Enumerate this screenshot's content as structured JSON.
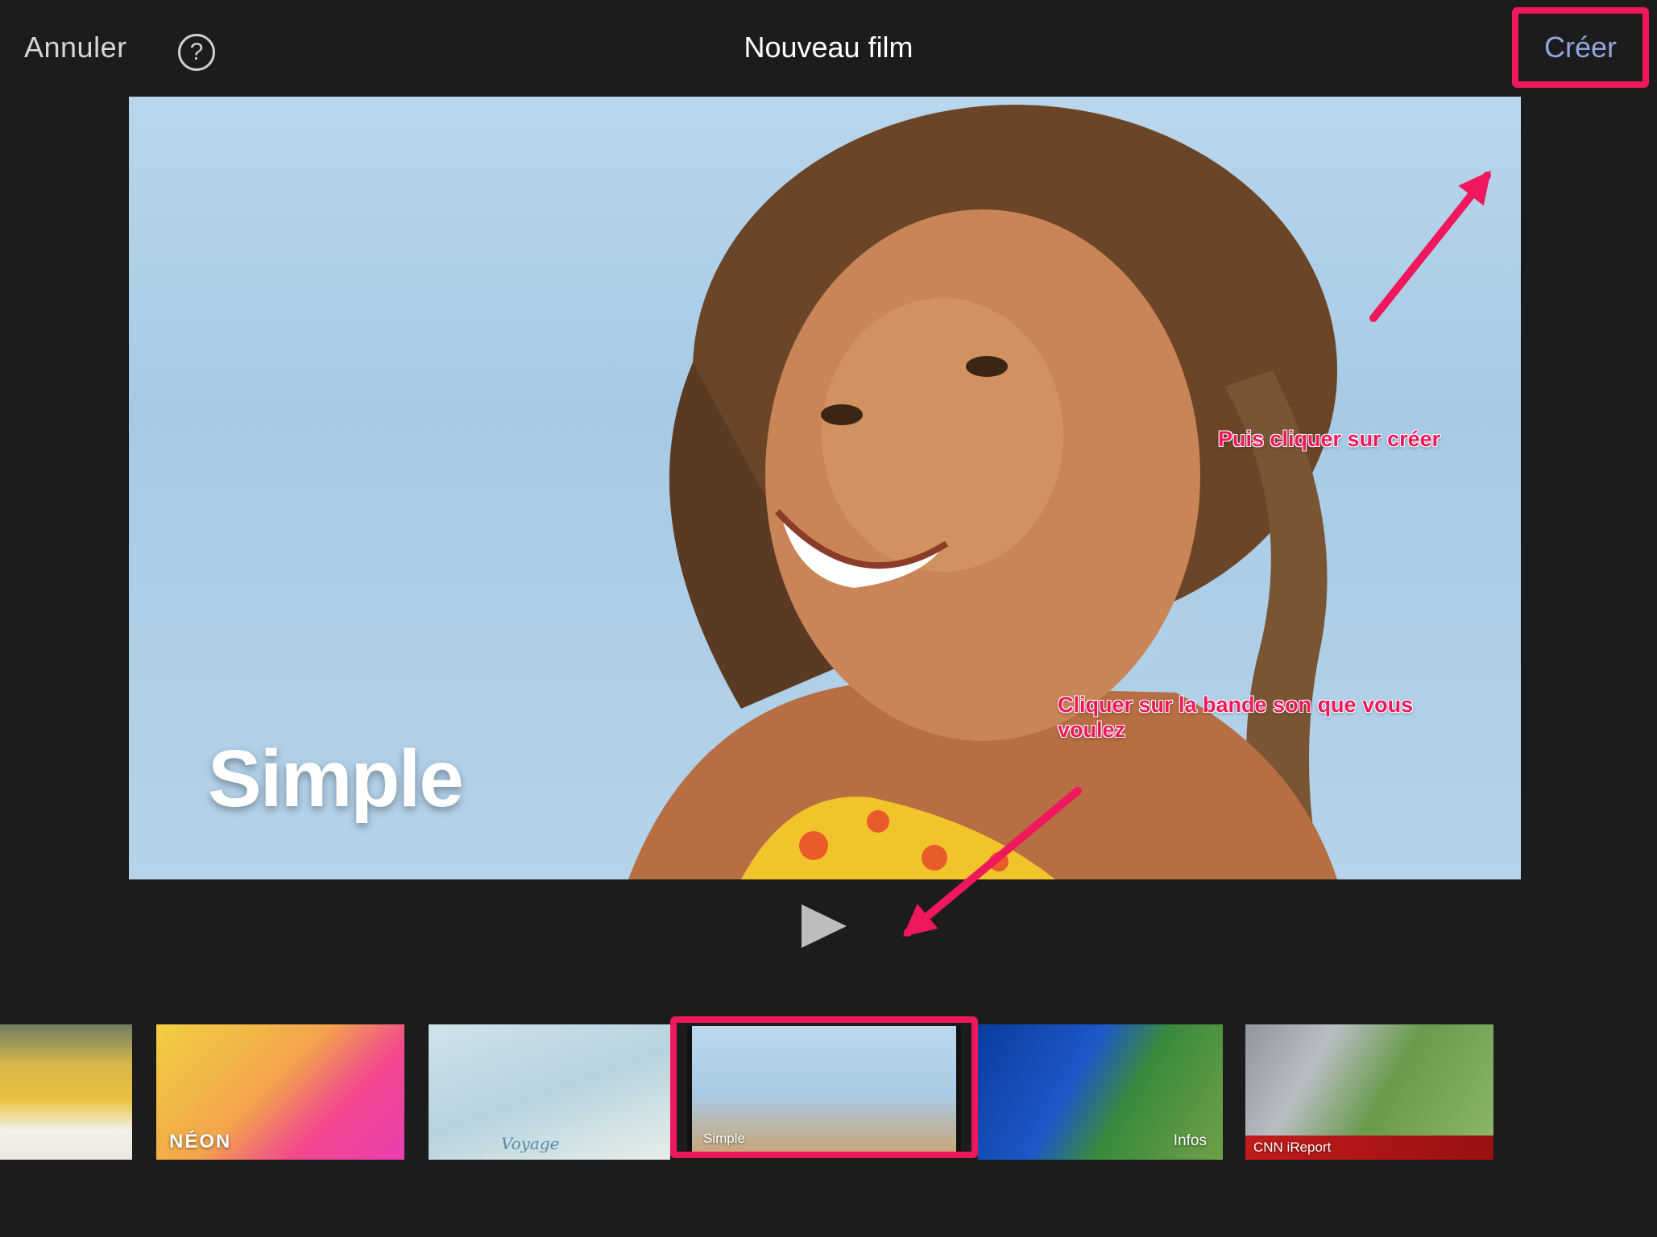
{
  "topbar": {
    "cancel_label": "Annuler",
    "help_label": "?",
    "title": "Nouveau film",
    "create_label": "Créer"
  },
  "preview": {
    "theme_label": "Simple"
  },
  "annotations": {
    "click_create": "Puis cliquer sur créer",
    "choose_soundtrack": "Cliquer sur la bande son que vous voulez"
  },
  "themes": [
    {
      "label": ""
    },
    {
      "label": "NÉON"
    },
    {
      "label": "Voyage"
    },
    {
      "label": "Simple",
      "selected": true
    },
    {
      "label": "Infos"
    },
    {
      "label": "CNN iReport"
    }
  ],
  "colors": {
    "background": "#1c1c1d",
    "highlight": "#f0185c",
    "accent_link": "#8fa6e0"
  }
}
